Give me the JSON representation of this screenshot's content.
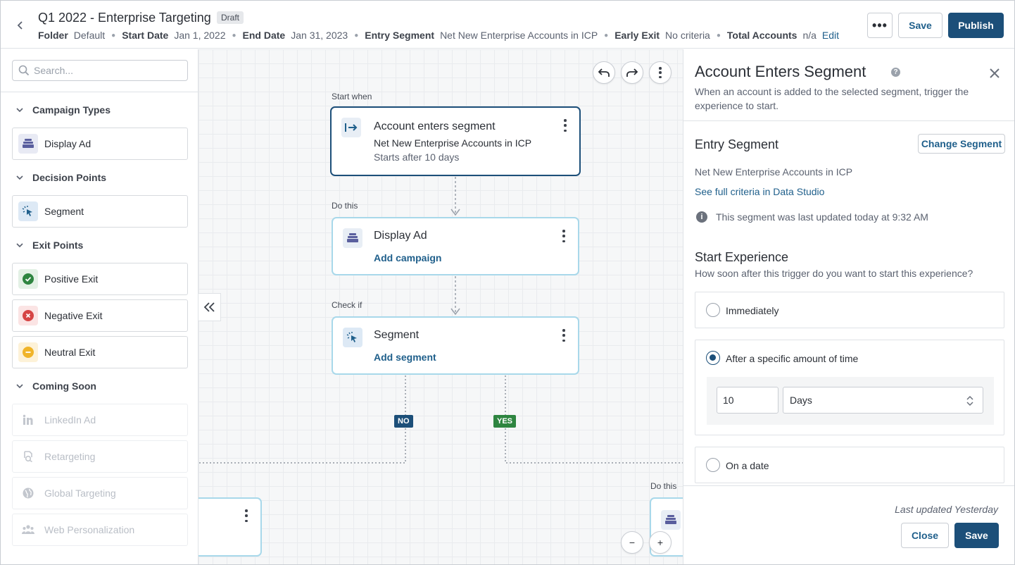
{
  "header": {
    "title": "Q1 2022 - Enterprise Targeting",
    "status_badge": "Draft",
    "meta": [
      {
        "key": "Folder",
        "value": "Default"
      },
      {
        "key": "Start Date",
        "value": "Jan 1, 2022"
      },
      {
        "key": "End Date",
        "value": "Jan 31, 2023"
      },
      {
        "key": "Entry Segment",
        "value": "Net New Enterprise Accounts in ICP"
      },
      {
        "key": "Early Exit",
        "value": "No criteria"
      },
      {
        "key": "Total Accounts",
        "value": "n/a"
      }
    ],
    "edit_label": "Edit",
    "more_label": "•••",
    "save_label": "Save",
    "publish_label": "Publish"
  },
  "sidebar": {
    "search_placeholder": "Search...",
    "sections": [
      {
        "label": "Campaign Types",
        "items": [
          {
            "label": "Display Ad",
            "icon": "display-ad-icon"
          }
        ]
      },
      {
        "label": "Decision Points",
        "items": [
          {
            "label": "Segment",
            "icon": "segment-pointer-icon"
          }
        ]
      },
      {
        "label": "Exit Points",
        "items": [
          {
            "label": "Positive Exit",
            "icon": "check-circle-icon",
            "color": "#2e8540"
          },
          {
            "label": "Negative Exit",
            "icon": "x-circle-icon",
            "color": "#d64545"
          },
          {
            "label": "Neutral Exit",
            "icon": "minus-circle-icon",
            "color": "#f0b429"
          }
        ]
      },
      {
        "label": "Coming Soon",
        "items": [
          {
            "label": "LinkedIn Ad",
            "icon": "linkedin-icon"
          },
          {
            "label": "Retargeting",
            "icon": "retargeting-icon"
          },
          {
            "label": "Global Targeting",
            "icon": "globe-icon"
          },
          {
            "label": "Web Personalization",
            "icon": "people-icon"
          }
        ]
      }
    ]
  },
  "canvas": {
    "start_when_label": "Start when",
    "do_this_label": "Do this",
    "check_if_label": "Check if",
    "do_this_label_2": "Do this",
    "nodes": [
      {
        "title": "Account enters segment",
        "subtitle": "Net New Enterprise Accounts in ICP",
        "detail": "Starts after 10 days"
      },
      {
        "title": "Display Ad",
        "link": "Add campaign"
      },
      {
        "title": "Segment",
        "link": "Add segment"
      }
    ],
    "branch_no": "NO",
    "branch_yes": "YES",
    "zoom_out": "−",
    "zoom_in": "+"
  },
  "panel": {
    "title": "Account Enters Segment",
    "help_glyph": "?",
    "description": "When an account is added to the selected segment, trigger the experience to start.",
    "entry_segment_heading": "Entry Segment",
    "change_segment_label": "Change Segment",
    "segment_name": "Net New Enterprise Accounts in ICP",
    "criteria_link": "See full criteria in Data Studio",
    "info_glyph": "i",
    "info_text": "This segment was last updated today at 9:32 AM",
    "start_heading": "Start Experience",
    "start_question": "How soon after this trigger do you want to start this experience?",
    "options": [
      {
        "label": "Immediately",
        "selected": false
      },
      {
        "label": "After a specific amount of time",
        "selected": true
      },
      {
        "label": "On a date",
        "selected": false
      }
    ],
    "delay_value": "10",
    "delay_unit": "Days",
    "last_updated": "Last updated Yesterday",
    "close_label": "Close",
    "save_label": "Save"
  },
  "colors": {
    "primary": "#1c4f79",
    "link": "#1f5f8b",
    "node_border": "#a8d8ea",
    "tag_no": "#1c4f79",
    "tag_yes": "#2e8540"
  }
}
